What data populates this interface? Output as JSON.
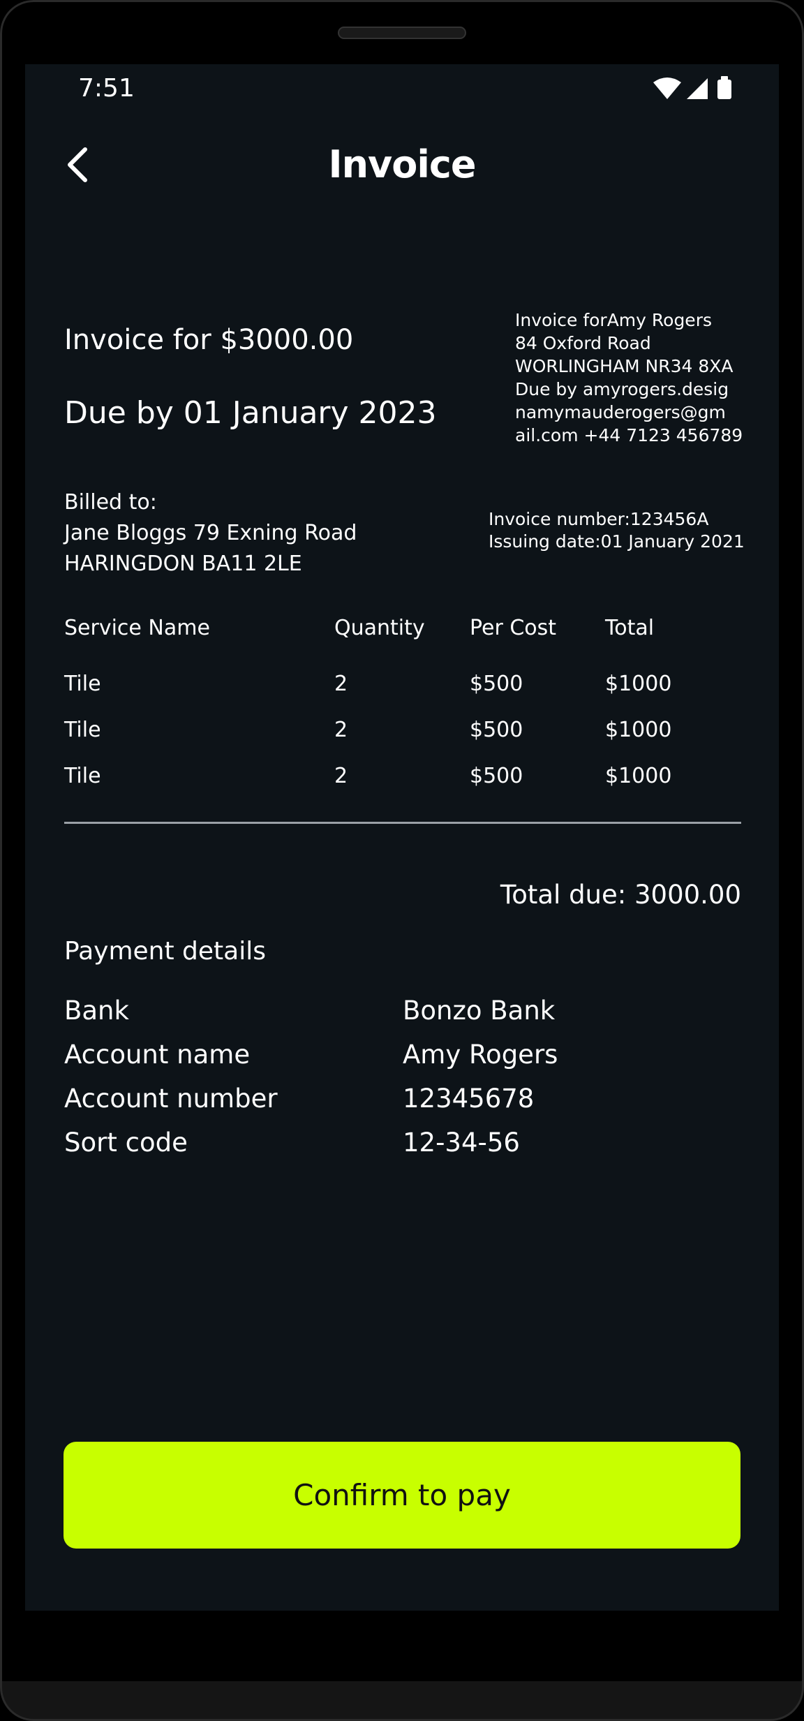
{
  "status_bar": {
    "time": "7:51",
    "icons": [
      "wifi-icon",
      "signal-icon",
      "battery-icon"
    ]
  },
  "header": {
    "title": "Invoice",
    "back_icon": "back-arrow-icon"
  },
  "summary": {
    "invoice_for": "Invoice for $3000.00",
    "due_by": "Due by 01 January 2023"
  },
  "sender": {
    "lines": [
      "Invoice forAmy Rogers",
      "84 Oxford Road",
      "WORLINGHAM NR34 8XA",
      "Due by amyrogers.desig",
      "namymauderogers@gm",
      "ail.com +44 7123 456789"
    ]
  },
  "billed": {
    "label": "Billed to:",
    "line1": "Jane Bloggs 79 Exning Road",
    "line2": "HARINGDON BA11 2LE"
  },
  "meta": {
    "invoice_number": "Invoice number:123456A",
    "issuing_date": "Issuing date:01 January 2021"
  },
  "table": {
    "headers": [
      "Service Name",
      "Quantity",
      "Per Cost",
      "Total"
    ],
    "rows": [
      [
        "Tile",
        "2",
        "$500",
        "$1000"
      ],
      [
        "Tile",
        "2",
        "$500",
        "$1000"
      ],
      [
        "Tile",
        "2",
        "$500",
        "$1000"
      ]
    ]
  },
  "total_due": "Total due: 3000.00",
  "payment": {
    "heading": "Payment details",
    "rows": [
      {
        "label": "Bank",
        "value": "Bonzo Bank"
      },
      {
        "label": "Account name",
        "value": "Amy Rogers"
      },
      {
        "label": "Account number",
        "value": "12345678"
      },
      {
        "label": "Sort code",
        "value": "12-34-56"
      }
    ]
  },
  "confirm_label": "Confirm to pay",
  "colors": {
    "background": "#0d1318",
    "accent": "#c8ff00",
    "text": "#ffffff",
    "divider": "#9aa0a6"
  }
}
